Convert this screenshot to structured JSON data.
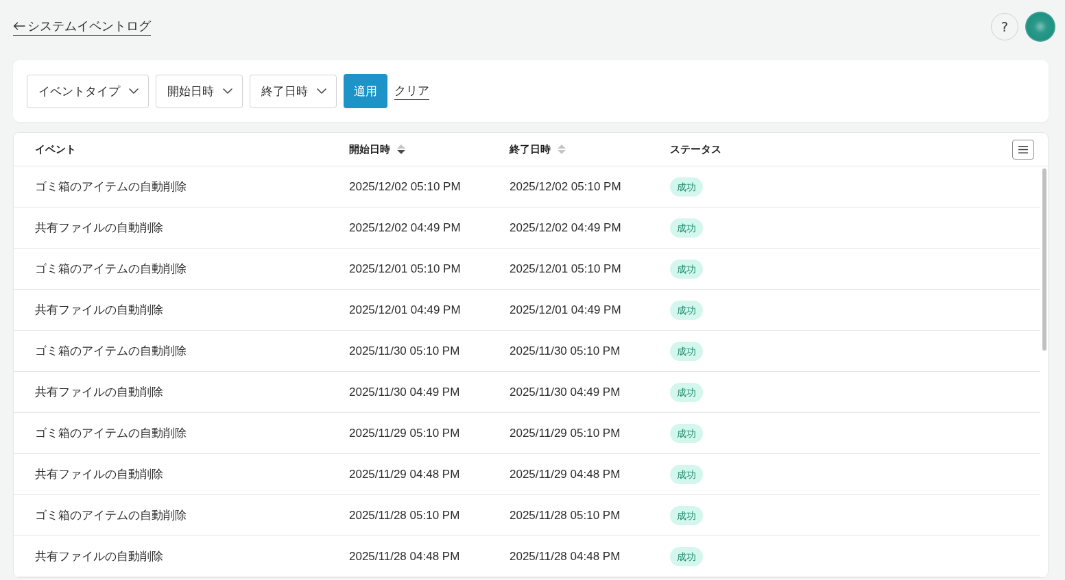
{
  "header": {
    "back_link": "システムイベントログ",
    "help_button": "?"
  },
  "filters": {
    "dropdowns": [
      {
        "label": "イベントタイプ"
      },
      {
        "label": "開始日時"
      },
      {
        "label": "終了日時"
      }
    ],
    "apply_button": "適用",
    "clear_link": "クリア"
  },
  "table": {
    "columns": [
      {
        "label": "イベント",
        "sortable": false
      },
      {
        "label": "開始日時",
        "sortable": true,
        "sort_descending": true
      },
      {
        "label": "終了日時",
        "sortable": true,
        "sort_descending": false
      },
      {
        "label": "ステータス",
        "sortable": false
      }
    ],
    "rows": [
      {
        "event": "ゴミ箱のアイテムの自動削除",
        "start": "2025/12/02 05:10 PM",
        "end": "2025/12/02 05:10 PM",
        "status": {
          "label": "成功",
          "kind": "success"
        }
      },
      {
        "event": "共有ファイルの自動削除",
        "start": "2025/12/02 04:49 PM",
        "end": "2025/12/02 04:49 PM",
        "status": {
          "label": "成功",
          "kind": "success"
        }
      },
      {
        "event": "ゴミ箱のアイテムの自動削除",
        "start": "2025/12/01 05:10 PM",
        "end": "2025/12/01 05:10 PM",
        "status": {
          "label": "成功",
          "kind": "success"
        }
      },
      {
        "event": "共有ファイルの自動削除",
        "start": "2025/12/01 04:49 PM",
        "end": "2025/12/01 04:49 PM",
        "status": {
          "label": "成功",
          "kind": "success"
        }
      },
      {
        "event": "ゴミ箱のアイテムの自動削除",
        "start": "2025/11/30 05:10 PM",
        "end": "2025/11/30 05:10 PM",
        "status": {
          "label": "成功",
          "kind": "success"
        }
      },
      {
        "event": "共有ファイルの自動削除",
        "start": "2025/11/30 04:49 PM",
        "end": "2025/11/30 04:49 PM",
        "status": {
          "label": "成功",
          "kind": "success"
        }
      },
      {
        "event": "ゴミ箱のアイテムの自動削除",
        "start": "2025/11/29 05:10 PM",
        "end": "2025/11/29 05:10 PM",
        "status": {
          "label": "成功",
          "kind": "success"
        }
      },
      {
        "event": "共有ファイルの自動削除",
        "start": "2025/11/29 04:48 PM",
        "end": "2025/11/29 04:48 PM",
        "status": {
          "label": "成功",
          "kind": "success"
        }
      },
      {
        "event": "ゴミ箱のアイテムの自動削除",
        "start": "2025/11/28 05:10 PM",
        "end": "2025/11/28 05:10 PM",
        "status": {
          "label": "成功",
          "kind": "success"
        }
      },
      {
        "event": "共有ファイルの自動削除",
        "start": "2025/11/28 04:48 PM",
        "end": "2025/11/28 04:48 PM",
        "status": {
          "label": "成功",
          "kind": "success"
        }
      }
    ]
  }
}
